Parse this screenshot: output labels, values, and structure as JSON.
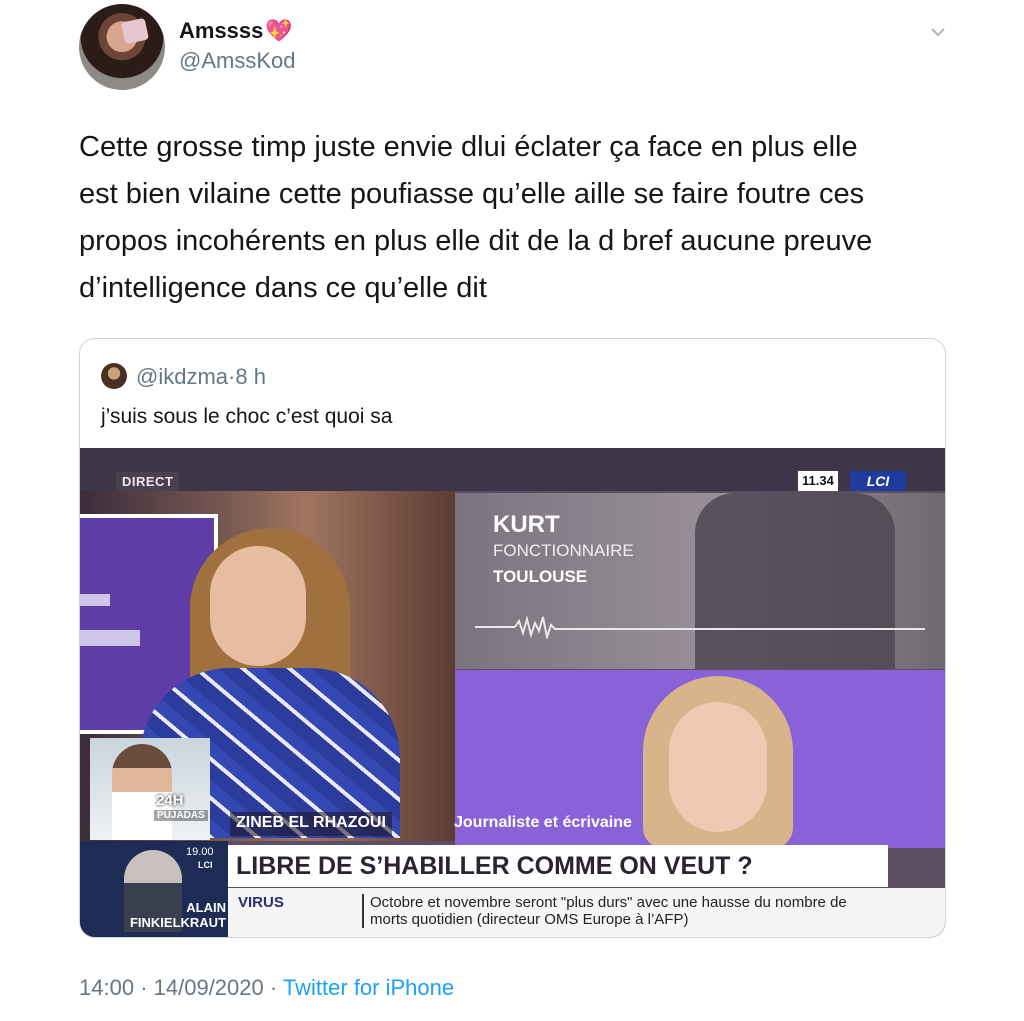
{
  "author": {
    "display_name": "Amssss",
    "emoji": "💖",
    "handle": "@AmssKod"
  },
  "tweet": {
    "text_lines": [
      "Cette grosse timp juste envie dlui éclater ça face en plus elle",
      "est bien vilaine cette poufiasse qu’elle aille se faire foutre ces",
      "propos incohérents en plus elle dit de la d bref aucune preuve",
      "d’intelligence dans ce qu’elle dit"
    ],
    "time": "14:00",
    "separator": "·",
    "date": "14/09/2020",
    "source": "Twitter for iPhone"
  },
  "quoted": {
    "handle": "@ikdzma",
    "dot": "·",
    "age": "8 h",
    "text": "j’suis sous le choc c’est quoi sa",
    "video": {
      "direct": "DIRECT",
      "clock": "11.34",
      "channel": "LCI",
      "kurt_name": "KURT",
      "kurt_job": "FONCTIONNAIRE",
      "kurt_city": "TOULOUSE",
      "show_24h": "24H",
      "show_pujadas": "PUJADAS",
      "guest_name": "ZINEB EL RHAZOUI",
      "guest_role": "Journaliste et écrivaine",
      "headline": "LIBRE DE S’HABILLER COMME ON VEUT ?",
      "ticker_tag": "VIRUS",
      "ticker_text": "Octobre et novembre seront \"plus durs\" avec une hausse du nombre de morts quotidien (directeur OMS Europe à l’AFP)",
      "show_time": "19.00",
      "show_channel": "LCI",
      "show_name_1": "ALAIN",
      "show_name_2": "FINKIELKRAUT"
    }
  },
  "colors": {
    "text": "#14171a",
    "secondary": "#657786",
    "link": "#1da1f2",
    "border": "#ccd6dd"
  }
}
